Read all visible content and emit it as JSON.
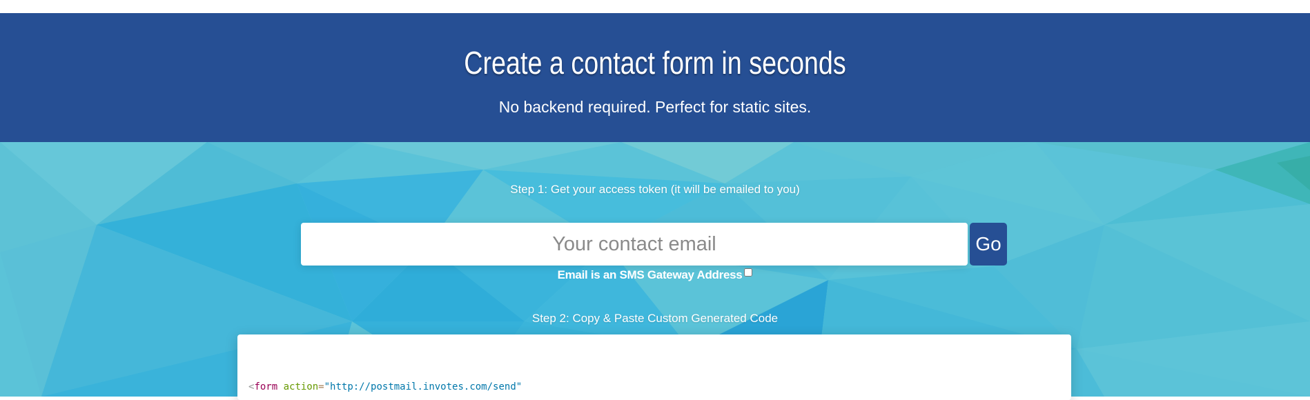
{
  "hero": {
    "title": "Create a contact form in seconds",
    "subtitle": "No backend required. Perfect for static sites.",
    "background_color": "#264f94"
  },
  "step1": {
    "label": "Step 1: Get your access token (it will be emailed to you)",
    "email_placeholder": "Your contact email",
    "email_value": "",
    "go_label": "Go",
    "sms_label": "Email is an SMS Gateway Address",
    "sms_checked": false
  },
  "step2": {
    "label": "Step 2: Copy & Paste Custom Generated Code",
    "code": {
      "open": "<",
      "tag": "form",
      "attr": "action",
      "eq": "=",
      "value": "\"http://postmail.invotes.com/send\""
    }
  },
  "colors": {
    "accent": "#264f94",
    "background_pattern": "#5bc3d8"
  }
}
